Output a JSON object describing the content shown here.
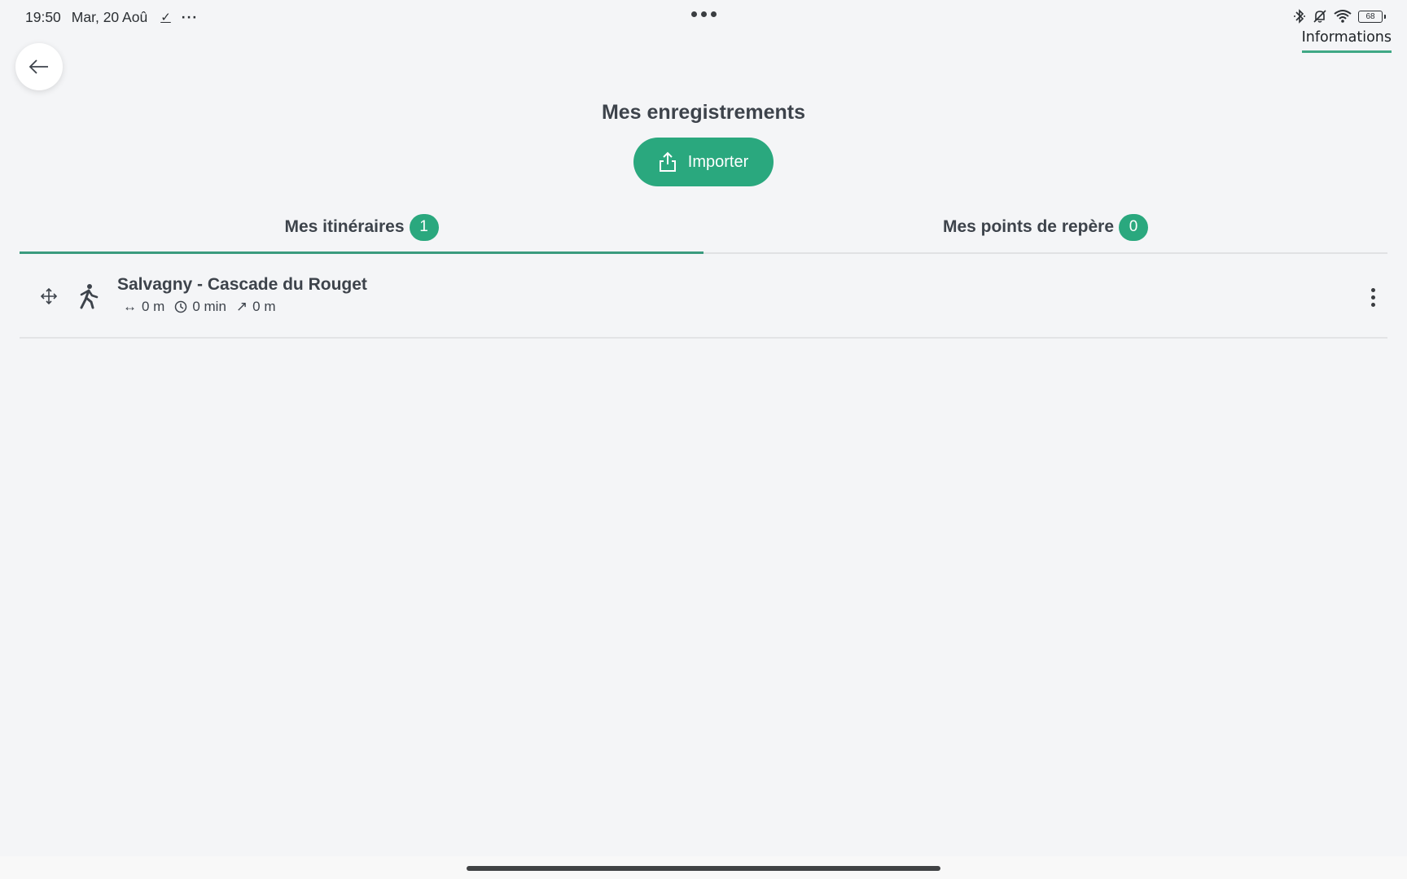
{
  "status_bar": {
    "time": "19:50",
    "date": "Mar, 20 Aoû",
    "check_glyph": "✓",
    "more_glyph": "···",
    "battery": "68",
    "icons": [
      "bluetooth-icon",
      "bell-off-icon",
      "wifi-icon",
      "battery-icon"
    ]
  },
  "header": {
    "info_tab": "Informations",
    "back_icon": "arrow-left-icon"
  },
  "main": {
    "title": "Mes enregistrements",
    "import_button": "Importer",
    "tabs": [
      {
        "label": "Mes itinéraires",
        "count": "1",
        "active": true
      },
      {
        "label": "Mes points de repère",
        "count": "0",
        "active": false
      }
    ],
    "routes": [
      {
        "title": "Salvagny - Cascade du Rouget",
        "activity": "walking",
        "distance": "0 m",
        "duration": "0 min",
        "elevation": "0 m"
      }
    ]
  },
  "colors": {
    "accent": "#2aa87e",
    "background": "#f4f5f7",
    "text": "#3d434b"
  }
}
